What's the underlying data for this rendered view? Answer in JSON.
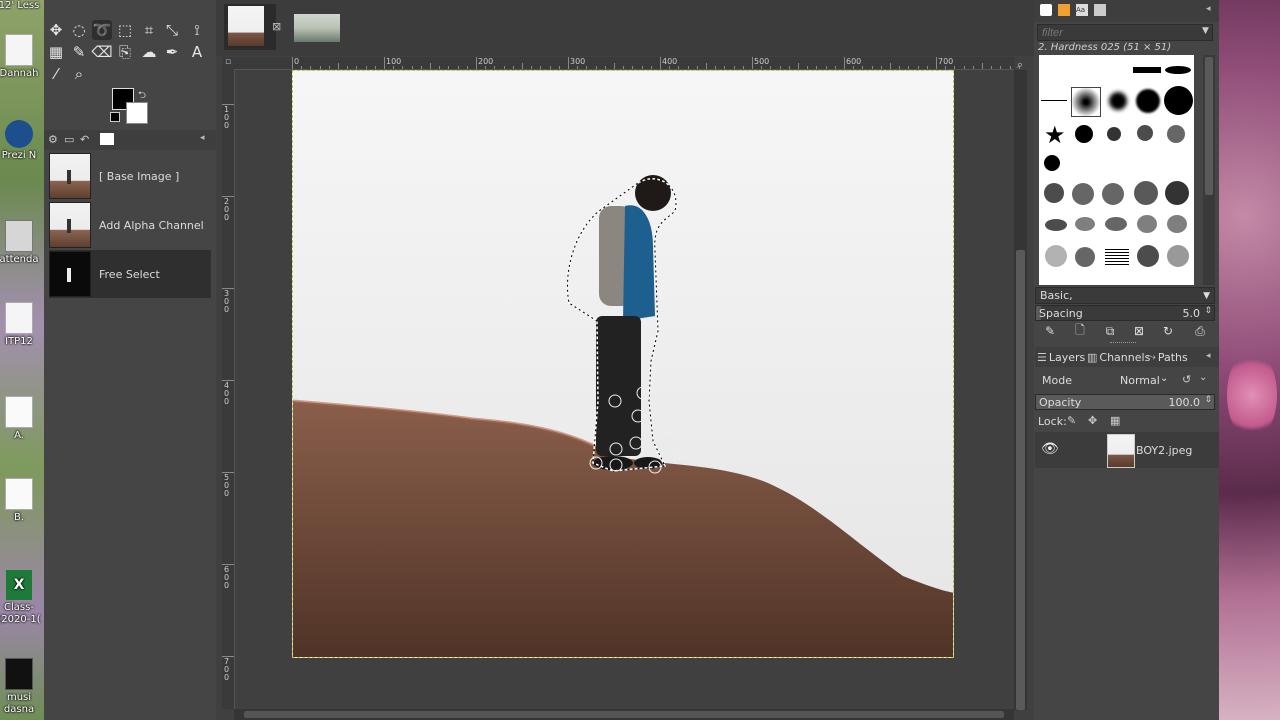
{
  "desktop": {
    "top_text": "12' Less",
    "icons": [
      {
        "label": "Dannah"
      },
      {
        "label": "Prezi N"
      },
      {
        "label": "attenda"
      },
      {
        "label": "ITP12"
      },
      {
        "label": "A."
      },
      {
        "label": "B."
      },
      {
        "label": "Class-(2020-1("
      },
      {
        "label": "musi dasna"
      }
    ]
  },
  "toolbox": {
    "history_items": [
      {
        "label": "[ Base Image ]"
      },
      {
        "label": "Add Alpha Channel"
      },
      {
        "label": "Free Select"
      }
    ],
    "colors": {
      "foreground": "#000000",
      "background": "#ffffff"
    }
  },
  "rulers": {
    "horizontal": [
      "0",
      "100",
      "200",
      "300",
      "400",
      "500",
      "600",
      "700"
    ],
    "vertical": [
      "100",
      "200",
      "300",
      "400",
      "500",
      "600",
      "700"
    ]
  },
  "canvas": {
    "image_name": "BOY2.jpeg",
    "selection_color": "#c8c850"
  },
  "brushes": {
    "filter_placeholder": "filter",
    "current_brush": "2. Hardness 025 (51 × 51)",
    "preset": "Basic,",
    "spacing_label": "Spacing",
    "spacing_value": "5.0"
  },
  "layers": {
    "tabs": [
      {
        "label": "Layers"
      },
      {
        "label": "Channels"
      },
      {
        "label": "Paths"
      }
    ],
    "mode_label": "Mode",
    "mode_value": "Normal",
    "opacity_label": "Opacity",
    "opacity_value": "100.0",
    "opacity_fraction": 1.0,
    "lock_label": "Lock:",
    "items": [
      {
        "name": "BOY2.jpeg",
        "visible": true
      }
    ]
  }
}
